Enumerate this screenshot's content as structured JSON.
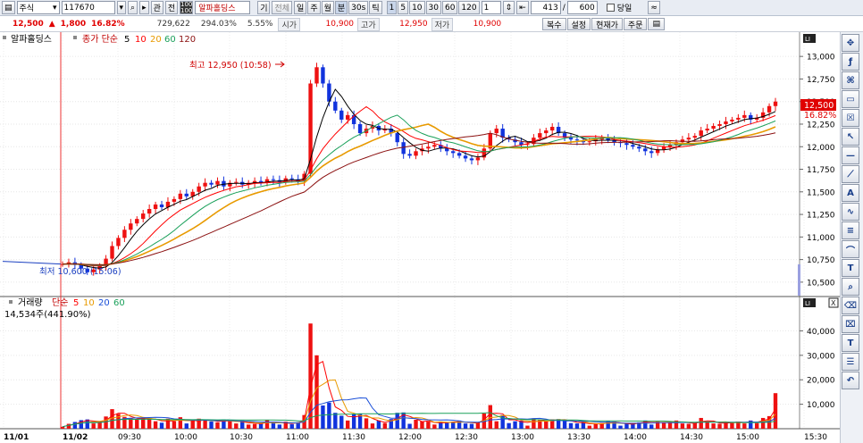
{
  "toolbar": {
    "market": "주식",
    "code": "117670",
    "btn_gwan": "관",
    "btn_jeon": "전",
    "stock_name": "알파홀딩스",
    "btn_gi": "기",
    "btn_all": "전체",
    "periods": [
      "일",
      "주",
      "월",
      "분",
      "30s",
      "틱"
    ],
    "intervals": [
      "1",
      "5",
      "10",
      "30",
      "60",
      "120"
    ],
    "multiplier": "1",
    "count_current": "413",
    "count_total": "600",
    "today_label": "당일"
  },
  "info": {
    "price": "12,500",
    "change": "1,800",
    "change_pct": "16.82%",
    "volume": "729,622",
    "volume_ratio": "294.03%",
    "turnover_pct": "5.55%",
    "open_label": "시가",
    "open_value": "10,900",
    "high_label": "고가",
    "high_value": "12,950",
    "low_label": "저가",
    "low_value": "10,900",
    "btn_copy": "복수",
    "btn_settings": "설정",
    "btn_current": "현재가",
    "btn_order": "주문"
  },
  "price_panel": {
    "series_name": "알파홀딩스",
    "ma_label": "종가 단순",
    "ma_periods": [
      "5",
      "10",
      "20",
      "60",
      "120"
    ],
    "ma_colors": [
      "#000000",
      "#ff0000",
      "#e89a00",
      "#1aa05a",
      "#8b1010"
    ],
    "high_annotation": "최고 12,950 (10:58)",
    "low_annotation": "최저 10,600 (15:06)",
    "current_price_tag": "12,500",
    "current_pct_tag": "16.82%"
  },
  "volume_panel": {
    "title": "거래량",
    "ma_label": "단순",
    "ma_periods": [
      "5",
      "10",
      "20",
      "60"
    ],
    "ma_colors": [
      "#ff0000",
      "#e89a00",
      "#1a4fd8",
      "#1aa05a"
    ],
    "readout": "14,534주(441.90%)"
  },
  "chart_data": {
    "type": "candlestick",
    "price_axis": {
      "ticks": [
        "13,000",
        "12,750",
        "12,500",
        "12,250",
        "12,000",
        "11,750",
        "11,500",
        "11,250",
        "11,000",
        "10,750",
        "10,500"
      ],
      "ylim": [
        10400,
        13150
      ]
    },
    "volume_axis": {
      "ticks": [
        "40,000",
        "30,000",
        "20,000",
        "10,000"
      ],
      "ylim": [
        0,
        46000
      ]
    },
    "x_ticks": [
      "11/01",
      "11/02",
      "09:30",
      "10:00",
      "10:30",
      "11:00",
      "11:30",
      "12:00",
      "12:30",
      "13:00",
      "13:30",
      "14:00",
      "14:30",
      "15:00",
      "15:30"
    ],
    "intraday_close": [
      10700,
      10720,
      10690,
      10650,
      10610,
      10640,
      10680,
      10760,
      10900,
      10990,
      11080,
      11150,
      11200,
      11260,
      11310,
      11360,
      11330,
      11390,
      11420,
      11480,
      11450,
      11500,
      11560,
      11600,
      11580,
      11620,
      11560,
      11600,
      11610,
      11580,
      11600,
      11620,
      11600,
      11640,
      11630,
      11610,
      11650,
      11640,
      11620,
      11700,
      12700,
      12880,
      12700,
      12500,
      12400,
      12300,
      12350,
      12250,
      12150,
      12200,
      12230,
      12180,
      12200,
      12150,
      12050,
      11920,
      11900,
      11950,
      11980,
      12000,
      12020,
      11980,
      11950,
      11930,
      11900,
      11870,
      11850,
      11880,
      11980,
      12150,
      12200,
      12100,
      12080,
      12050,
      12020,
      12030,
      12100,
      12150,
      12180,
      12220,
      12150,
      12100,
      12080,
      12070,
      12050,
      12060,
      12080,
      12100,
      12070,
      12050,
      12040,
      12020,
      12000,
      11980,
      11950,
      11930,
      11970,
      12000,
      12020,
      12050,
      12080,
      12100,
      12120,
      12180,
      12200,
      12230,
      12250,
      12280,
      12300,
      12320,
      12350,
      12300,
      12320,
      12380,
      12450,
      12500
    ],
    "volume_spikes": [
      {
        "label": "11:00",
        "value": 43000
      },
      {
        "label": "15:30",
        "value": 14534
      }
    ]
  },
  "right_tools": [
    "cross-tool-icon",
    "indicator-tool-icon",
    "pattern-tool-icon",
    "text-box-tool-icon",
    "select-tool-icon",
    "cursor-tool-icon",
    "line-tool-icon",
    "trend-line-tool-icon",
    "auto-trend-tool-icon",
    "wave-tool-icon",
    "fibonacci-tool-icon",
    "fan-tool-icon",
    "text-tool-icon",
    "magnifier-tool-icon",
    "erase-tool-icon",
    "erase-all-tool-icon",
    "text-input-tool-icon",
    "list-tool-icon",
    "rotate-tool-icon"
  ]
}
